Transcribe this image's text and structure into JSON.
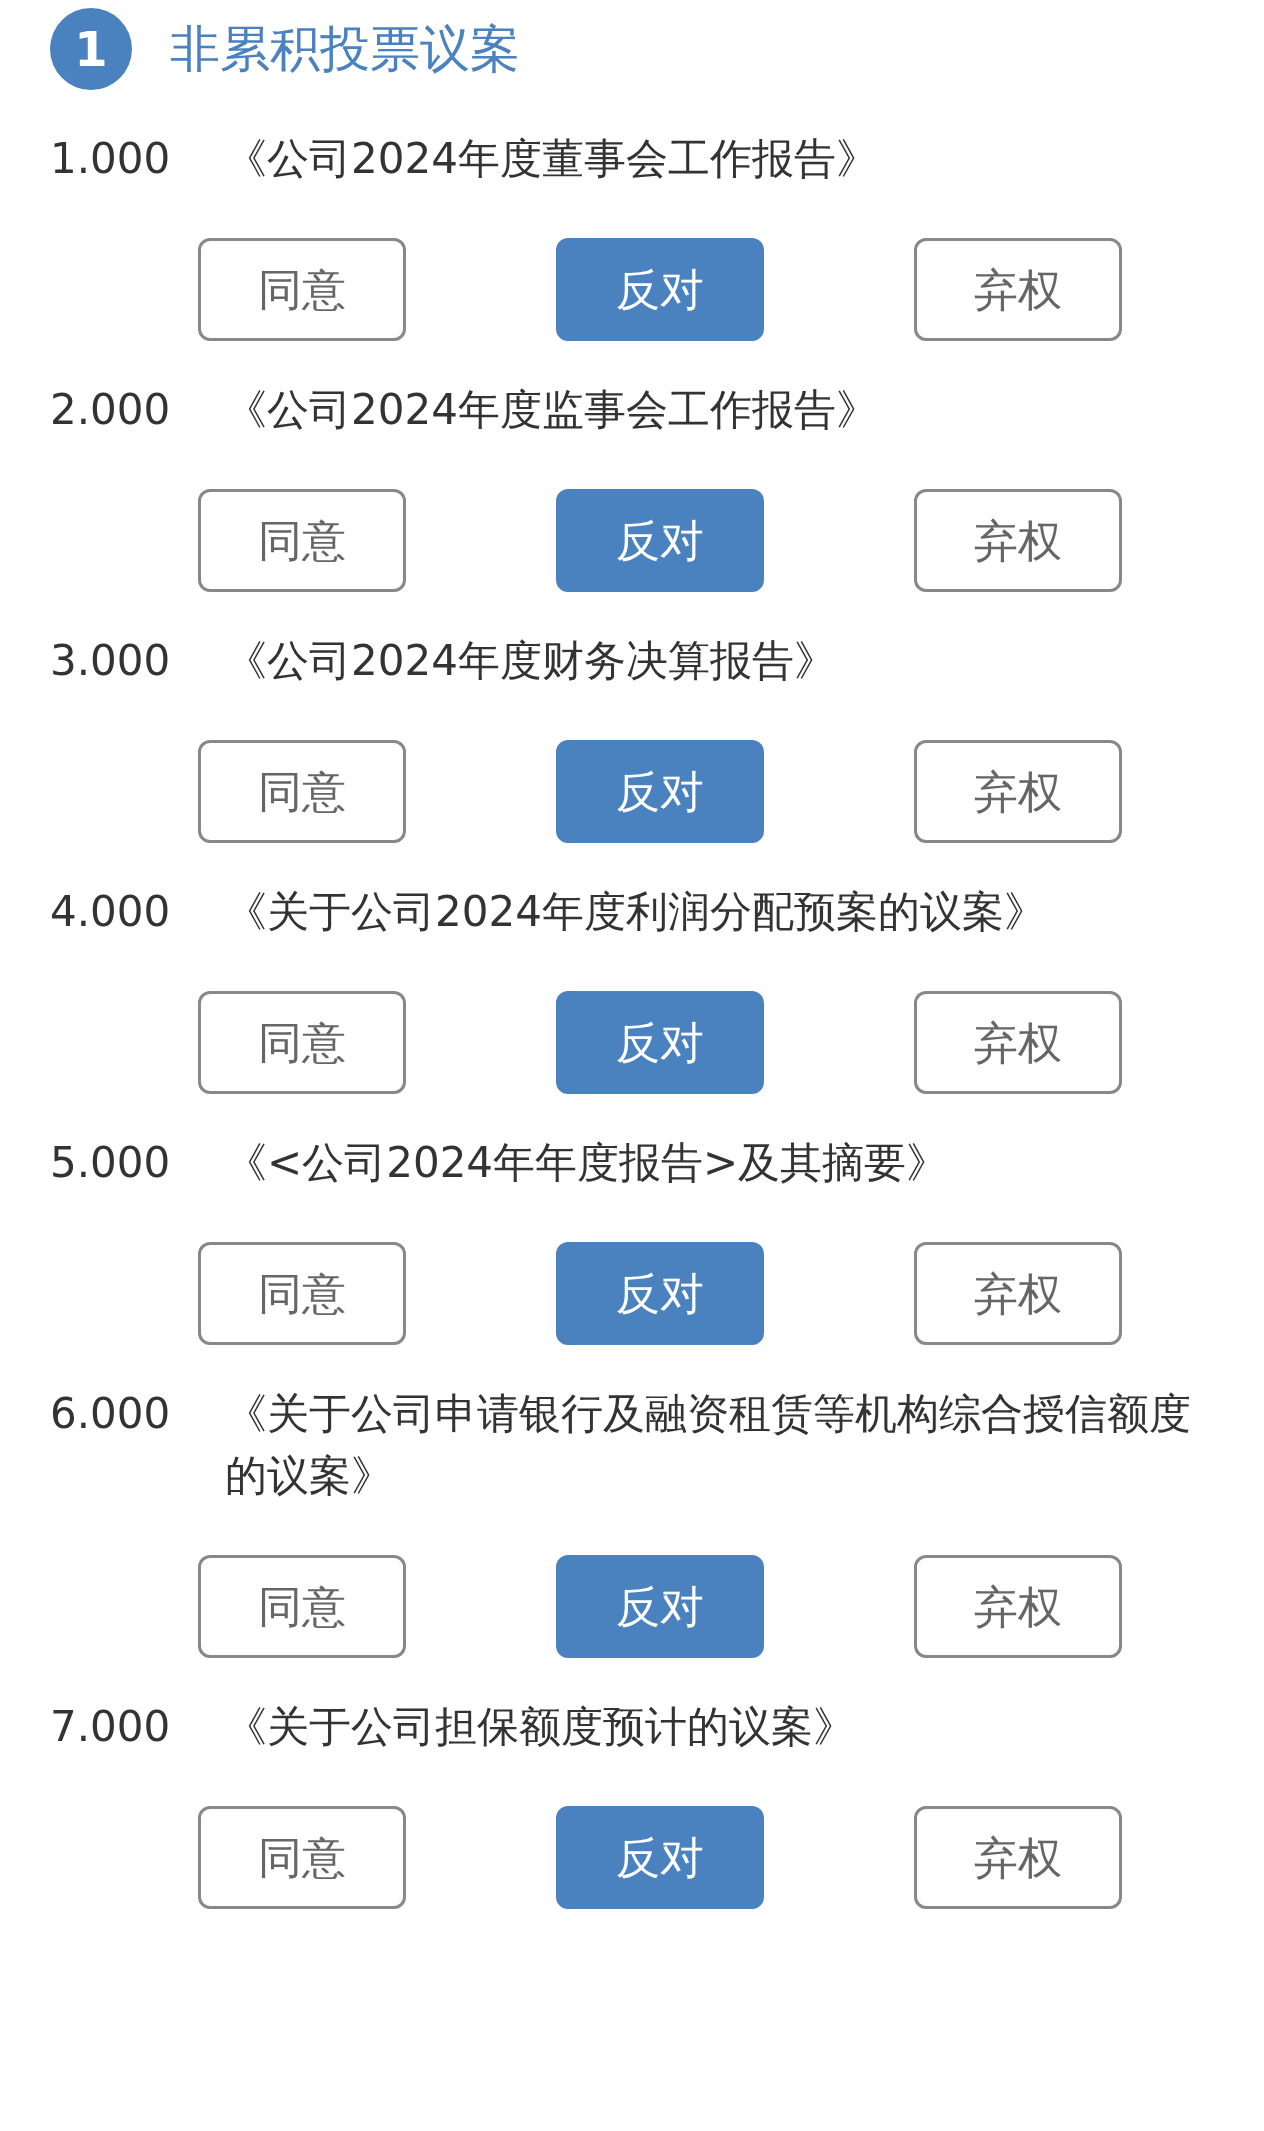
{
  "section": {
    "number": "1",
    "title": "非累积投票议案"
  },
  "proposals": [
    {
      "code": "1.000",
      "title": "《公司2024年度董事会工作报告》",
      "options": [
        {
          "label": "同意",
          "selected": false
        },
        {
          "label": "反对",
          "selected": true
        },
        {
          "label": "弃权",
          "selected": false
        }
      ]
    },
    {
      "code": "2.000",
      "title": "《公司2024年度监事会工作报告》",
      "options": [
        {
          "label": "同意",
          "selected": false
        },
        {
          "label": "反对",
          "selected": true
        },
        {
          "label": "弃权",
          "selected": false
        }
      ]
    },
    {
      "code": "3.000",
      "title": "《公司2024年度财务决算报告》",
      "options": [
        {
          "label": "同意",
          "selected": false
        },
        {
          "label": "反对",
          "selected": true
        },
        {
          "label": "弃权",
          "selected": false
        }
      ]
    },
    {
      "code": "4.000",
      "title": "《关于公司2024年度利润分配预案的议案》",
      "options": [
        {
          "label": "同意",
          "selected": false
        },
        {
          "label": "反对",
          "selected": true
        },
        {
          "label": "弃权",
          "selected": false
        }
      ]
    },
    {
      "code": "5.000",
      "title": "《<公司2024年年度报告>及其摘要》",
      "options": [
        {
          "label": "同意",
          "selected": false
        },
        {
          "label": "反对",
          "selected": true
        },
        {
          "label": "弃权",
          "selected": false
        }
      ]
    },
    {
      "code": "6.000",
      "title": "《关于公司申请银行及融资租赁等机构综合授信额度的议案》",
      "options": [
        {
          "label": "同意",
          "selected": false
        },
        {
          "label": "反对",
          "selected": true
        },
        {
          "label": "弃权",
          "selected": false
        }
      ]
    },
    {
      "code": "7.000",
      "title": "《关于公司担保额度预计的议案》",
      "options": [
        {
          "label": "同意",
          "selected": false
        },
        {
          "label": "反对",
          "selected": true
        },
        {
          "label": "弃权",
          "selected": false
        }
      ]
    }
  ]
}
